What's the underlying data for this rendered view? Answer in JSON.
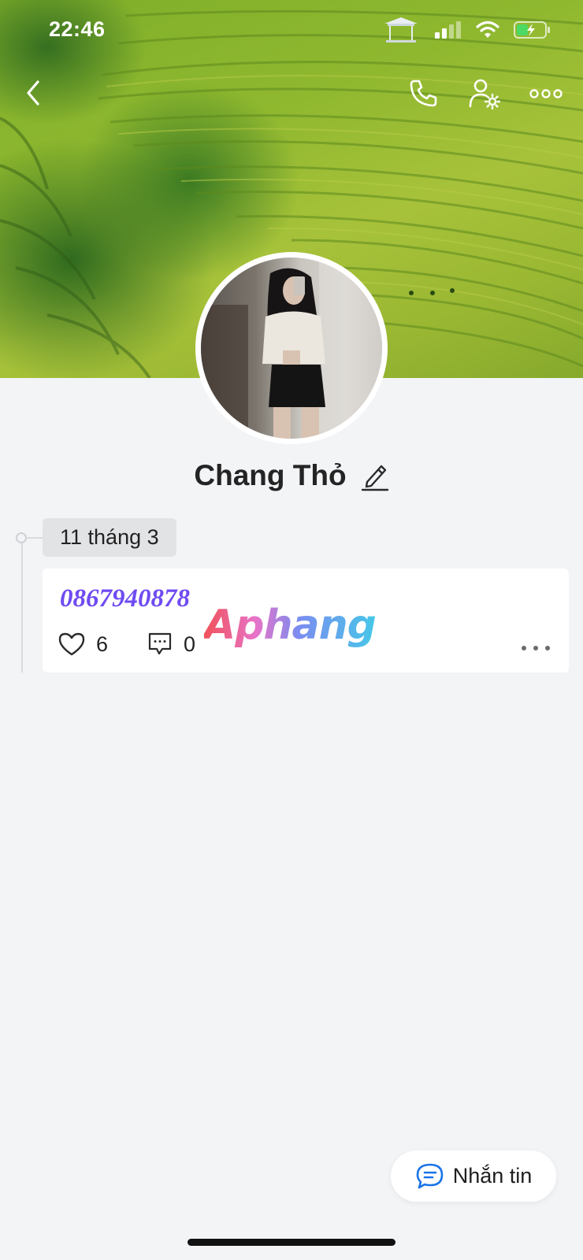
{
  "status_bar": {
    "time": "22:46"
  },
  "nav": {
    "back_icon": "chevron-left-icon",
    "call_icon": "phone-icon",
    "settings_icon": "user-settings-icon",
    "more_icon": "more-dots-icon"
  },
  "profile": {
    "name": "Chang Thỏ",
    "edit_icon": "pencil-icon"
  },
  "timeline": {
    "date_label": "11 tháng 3"
  },
  "post": {
    "text": "0867940878",
    "watermark": "Aphang",
    "likes": "6",
    "comments": "0"
  },
  "message_button": {
    "label": "Nhắn tin",
    "icon": "chat-bubble-icon"
  },
  "colors": {
    "accent_purple": "#6f4bf2",
    "background": "#f3f4f6",
    "fab_icon_blue": "#1a73e8"
  }
}
